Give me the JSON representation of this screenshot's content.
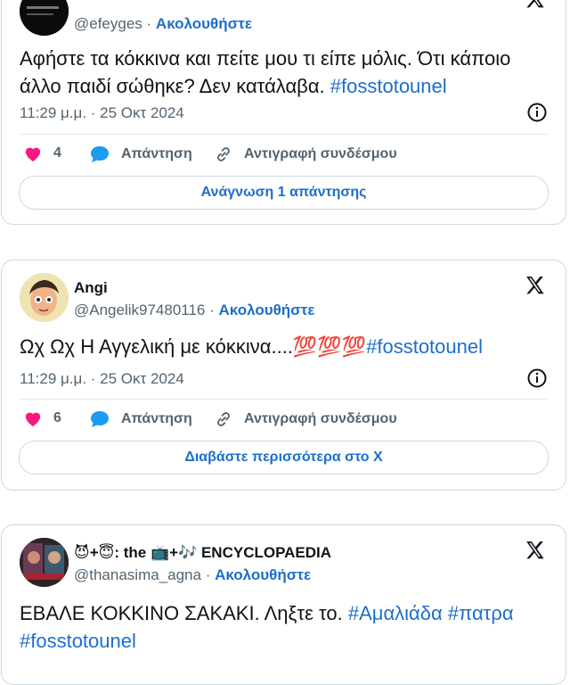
{
  "colors": {
    "link": "#1d6fc9",
    "muted": "#536471",
    "border": "#cfd9de",
    "heart": "#f91880"
  },
  "tweets": [
    {
      "name": "",
      "handle": "@efeyges",
      "follow": "Ακολουθήστε",
      "text": "Αφήστε τα κόκκινα και πείτε μου τι είπε μόλις. Ότι κάποιο άλλο παιδί σώθηκε? Δεν κατάλαβα.",
      "hashtag": "#fosstotounel",
      "time": "11:29 μ.μ. · 25 Οκτ 2024",
      "likes": "4",
      "reply": "Απάντηση",
      "copy": "Αντιγραφή συνδέσμου",
      "button": "Ανάγνωση 1 απάντησης"
    },
    {
      "name": "Angi",
      "handle": "@Angelik97480116",
      "follow": "Ακολουθήστε",
      "text": "Ωχ Ωχ Η Αγγελική με κόκκινα....💯💯💯",
      "hashtag": "#fosstotounel",
      "time": "11:29 μ.μ. · 25 Οκτ 2024",
      "likes": "6",
      "reply": "Απάντηση",
      "copy": "Αντιγραφή συνδέσμου",
      "button": "Διαβάστε περισσότερα στο X"
    },
    {
      "name": "😈+😇: the 📺+🎶 ENCYCLOPAEDIA",
      "handle": "@thanasima_agna",
      "follow": "Ακολουθήστε",
      "text": "ΕΒΑΛΕ ΚΟΚΚΙΝΟ ΣΑΚΑΚΙ. Ληξτε το.",
      "hashtags": [
        "#Αμαλιάδα",
        "#πατρα",
        "#fosstotounel"
      ]
    }
  ]
}
